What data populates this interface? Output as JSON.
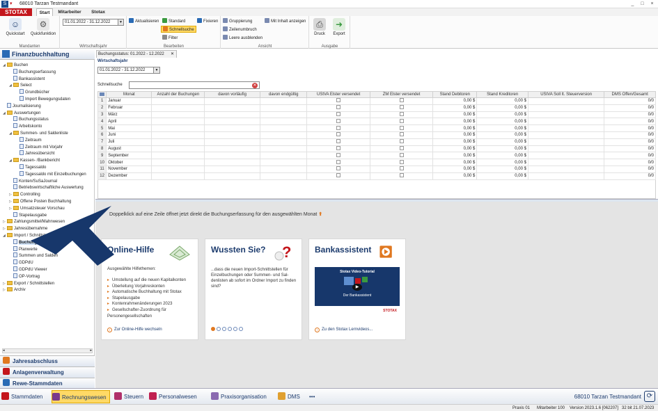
{
  "window": {
    "title": "68010 Tarzan Testmandant",
    "icon": "app-icon",
    "controls": [
      "_",
      "□",
      "×"
    ]
  },
  "brand": {
    "logo": "STOTAX",
    "color": "#c4161c"
  },
  "ribbon_tabs": [
    {
      "label": "Start",
      "active": true
    },
    {
      "label": "Mitarbeiter",
      "active": false
    },
    {
      "label": "Stotax",
      "active": false
    }
  ],
  "ribbon": {
    "groups": [
      {
        "label": "Mandanten",
        "buttons": [
          "Quickstart",
          "Quickfunktion"
        ]
      },
      {
        "label": "Wirtschaftsjahr",
        "select": "01.01.2022 - 31.12.2022"
      },
      {
        "label": "Bearbeiten",
        "buttons": [
          "Aktualisieren",
          "Standard",
          "Schnellsuche",
          "Filter",
          "Fixieren"
        ]
      },
      {
        "label": "Ansicht",
        "buttons": [
          "Gruppierung",
          "Zeilenumbruch",
          "Leere ausblenden",
          "Mit Inhalt anzeigen"
        ]
      },
      {
        "label": "Ausgabe",
        "buttons": [
          "Druck",
          "Export"
        ]
      }
    ]
  },
  "left": {
    "title": "Finanzbuchhaltung",
    "tree": [
      {
        "label": "Buchen",
        "level": 0,
        "type": "folder",
        "exp": "▲"
      },
      {
        "label": "Buchungserfassung",
        "level": 1,
        "type": "doc"
      },
      {
        "label": "Bankassistent",
        "level": 1,
        "type": "doc"
      },
      {
        "label": "Select",
        "level": 1,
        "type": "folder",
        "exp": "▲"
      },
      {
        "label": "Grundbücher",
        "level": 2,
        "type": "doc"
      },
      {
        "label": "Import Bewegungsdaten",
        "level": 2,
        "type": "doc"
      },
      {
        "label": "Journalisierung",
        "level": 0,
        "type": "doc"
      },
      {
        "label": "Auswertungen",
        "level": 0,
        "type": "folder",
        "exp": "▲"
      },
      {
        "label": "Buchungsstatus",
        "level": 1,
        "type": "doc"
      },
      {
        "label": "Arbeitskonto",
        "level": 1,
        "type": "doc"
      },
      {
        "label": "Summen- und Saldenliste",
        "level": 1,
        "type": "folder",
        "exp": "▲"
      },
      {
        "label": "Zeitraum",
        "level": 2,
        "type": "doc"
      },
      {
        "label": "Zeitraum mit Vorjahr",
        "level": 2,
        "type": "doc"
      },
      {
        "label": "Jahresübersicht",
        "level": 2,
        "type": "doc"
      },
      {
        "label": "Kassen- /Bankbericht",
        "level": 1,
        "type": "folder",
        "exp": "▲"
      },
      {
        "label": "Tagessaldo",
        "level": 2,
        "type": "doc"
      },
      {
        "label": "Tagessaldo mit Einzelbuchungen",
        "level": 2,
        "type": "doc"
      },
      {
        "label": "Konten/SuSaJournal",
        "level": 1,
        "type": "doc"
      },
      {
        "label": "Betriebswirtschaftliche Auswertung",
        "level": 1,
        "type": "doc"
      },
      {
        "label": "Controlling",
        "level": 1,
        "type": "folder",
        "exp": "▷"
      },
      {
        "label": "Offene Posten Buchhaltung",
        "level": 1,
        "type": "folder",
        "exp": "▷"
      },
      {
        "label": "Umsatzsteuer Vorschau",
        "level": 1,
        "type": "folder",
        "exp": "▷"
      },
      {
        "label": "Stapelausgabe",
        "level": 1,
        "type": "doc"
      },
      {
        "label": "Zahlungsmittel/Mahnwesen",
        "level": 0,
        "type": "folder",
        "exp": "▷"
      },
      {
        "label": "Jahresübernahme",
        "level": 0,
        "type": "folder",
        "exp": "▷"
      },
      {
        "label": "Import / Schnittstellen",
        "level": 0,
        "type": "folder",
        "exp": "▲"
      },
      {
        "label": "Buchungen",
        "level": 1,
        "type": "doc",
        "selected": true
      },
      {
        "label": "Planwerte",
        "level": 1,
        "type": "doc"
      },
      {
        "label": "Summen und Salden",
        "level": 1,
        "type": "doc"
      },
      {
        "label": "GDPdU",
        "level": 1,
        "type": "doc"
      },
      {
        "label": "GDPdU Viewer",
        "level": 1,
        "type": "doc"
      },
      {
        "label": "OP-Vortrag",
        "level": 1,
        "type": "doc"
      },
      {
        "label": "Export / Schnittstellen",
        "level": 0,
        "type": "folder",
        "exp": "▷"
      },
      {
        "label": "Archiv",
        "level": 0,
        "type": "folder",
        "exp": "▷"
      }
    ],
    "nav": [
      "Jahresabschluss",
      "Anlagenverwaltung",
      "Rewe-Stammdaten"
    ]
  },
  "content": {
    "doc_tab": "Buchungsstatus: 01.2022 - 12.2022",
    "wj_label": "Wirtschaftsjahr",
    "wj_value": "01.01.2022 - 31.12.2022",
    "search_label": "Schnellsuche",
    "columns": [
      "Monat",
      "Anzahl der Buchungen",
      "davon vorläufig",
      "davon endgültig",
      "UStVA Elster versendet",
      "ZM Elster versendet",
      "Stand Debitoren",
      "Stand Kreditoren",
      "UStVA Soll lt. Steuerversion",
      "DMS Offen/Gesamt"
    ],
    "rows": [
      {
        "n": "1",
        "month": "Januar",
        "deb": "0,00 $",
        "kred": "0,00 $",
        "dms": "0/0"
      },
      {
        "n": "2",
        "month": "Februar",
        "deb": "0,00 $",
        "kred": "0,00 $",
        "dms": "0/0"
      },
      {
        "n": "3",
        "month": "März",
        "deb": "0,00 $",
        "kred": "0,00 $",
        "dms": "0/0"
      },
      {
        "n": "4",
        "month": "April",
        "deb": "0,00 $",
        "kred": "0,00 $",
        "dms": "0/0"
      },
      {
        "n": "5",
        "month": "Mai",
        "deb": "0,00 $",
        "kred": "0,00 $",
        "dms": "0/0"
      },
      {
        "n": "6",
        "month": "Juni",
        "deb": "0,00 $",
        "kred": "0,00 $",
        "dms": "0/0"
      },
      {
        "n": "7",
        "month": "Juli",
        "deb": "0,00 $",
        "kred": "0,00 $",
        "dms": "0/0"
      },
      {
        "n": "8",
        "month": "August",
        "deb": "0,00 $",
        "kred": "0,00 $",
        "dms": "0/0"
      },
      {
        "n": "9",
        "month": "September",
        "deb": "0,00 $",
        "kred": "0,00 $",
        "dms": "0/0"
      },
      {
        "n": "10",
        "month": "Oktober",
        "deb": "0,00 $",
        "kred": "0,00 $",
        "dms": "0/0"
      },
      {
        "n": "11",
        "month": "November",
        "deb": "0,00 $",
        "kred": "0,00 $",
        "dms": "0/0"
      },
      {
        "n": "12",
        "month": "Dezember",
        "deb": "0,00 $",
        "kred": "0,00 $",
        "dms": "0/0"
      }
    ],
    "hint": "Doppelklick auf eine Zeile öffnet jetzt direkt die Buchungserfassung für den ausgewählten Monat",
    "cards": {
      "help": {
        "title": "Online-Hilfe",
        "subtitle": "Ausgewählte Hilfethemen:",
        "items": [
          "Umstellung auf die neuen Kapitalkonten",
          "Überleitung Vorjahreskonten",
          "Automatische Buchhaltung mit Stotax",
          "Stapelausgabe",
          "Kontenrahmenänderungen 2023",
          "Gesellschafter-Zuordnung für Personengesellschaften"
        ],
        "link": "Zur Online-Hilfe wechseln"
      },
      "tip": {
        "title": "Wussten Sie?",
        "text": "...dass die neuen Import-Schnittstellen für Einzelbuchungen oder Summen- und Sal-denlisten ab sofort im Ordner Import zu finden sind?",
        "dots": 6,
        "active_dot": 0
      },
      "bank": {
        "title": "Bankassistent",
        "video_title": "Stotax Video-Tutorial",
        "video_sub": "Der Bankassistent",
        "video_brand": "STOTAX",
        "link": "Zu den Stotax Lernvideos..."
      }
    }
  },
  "taskbar": {
    "items": [
      {
        "label": "Stammdaten",
        "color": "#c4161c"
      },
      {
        "label": "Rechnungswesen",
        "color": "#7a3a8c",
        "active": true
      },
      {
        "label": "Steuern",
        "color": "#b0306a"
      },
      {
        "label": "Personalwesen",
        "color": "#c02050"
      },
      {
        "label": "Praxisorganisation",
        "color": "#8a6ab0"
      },
      {
        "label": "DMS",
        "color": "#e0a030"
      },
      {
        "label": "•••",
        "color": "#1d3c6e"
      }
    ],
    "mandant": "68010 Tarzan Testmandant"
  },
  "status": {
    "praxis": "Praxis 01",
    "mitarbeiter": "Mitarbeiter 100",
    "version": "Version 2023.1.6 [062207]",
    "build": "32 bit 21.07.2023"
  },
  "colors": {
    "accent": "#1d3c6e",
    "highlight": "#ffd966",
    "orange": "#e07820"
  }
}
